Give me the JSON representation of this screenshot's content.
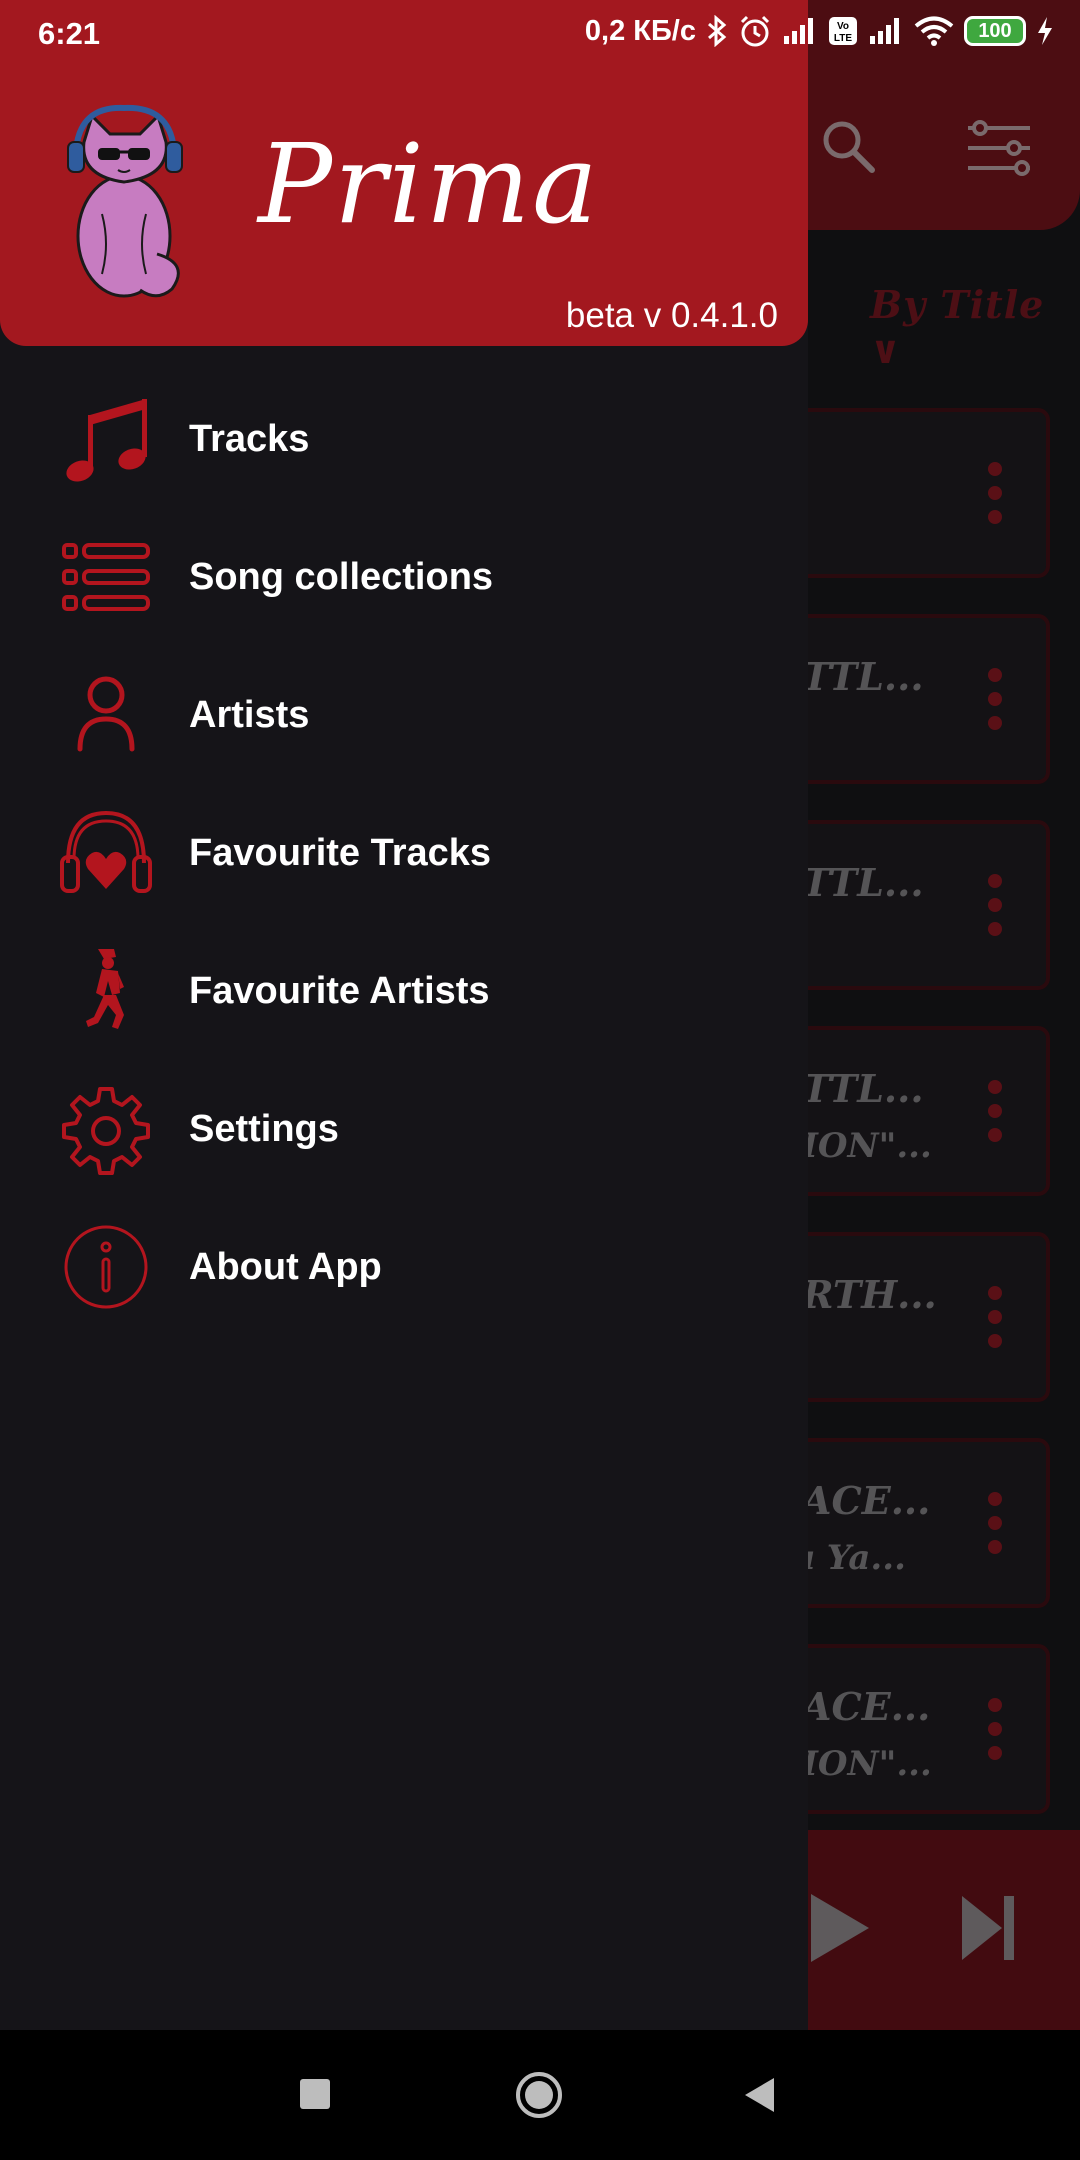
{
  "status_bar": {
    "time": "6:21",
    "network_speed": "0,2 КБ/с",
    "battery_level": "100"
  },
  "drawer": {
    "app_title": "Prima",
    "version": "beta v 0.4.1.0",
    "menu": [
      {
        "label": "Tracks",
        "icon": "music-notes-icon"
      },
      {
        "label": "Song collections",
        "icon": "list-icon"
      },
      {
        "label": "Artists",
        "icon": "person-icon"
      },
      {
        "label": "Favourite Tracks",
        "icon": "headphones-heart-icon"
      },
      {
        "label": "Favourite Artists",
        "icon": "dancer-icon"
      },
      {
        "label": "Settings",
        "icon": "gear-icon"
      },
      {
        "label": "About App",
        "icon": "info-icon"
      }
    ]
  },
  "background": {
    "sort_label": "By Title",
    "items": [
      {
        "t1": "",
        "t2": ""
      },
      {
        "t1": "TTL...",
        "t2": ""
      },
      {
        "t1": "TTL...",
        "t2": ""
      },
      {
        "t1": "TTL...",
        "t2": "ION\"..."
      },
      {
        "t1": "RTH...",
        "t2": ""
      },
      {
        "t1": "ACE...",
        "t2": "ı Ya..."
      },
      {
        "t1": "ACE...",
        "t2": "ION\"..."
      }
    ]
  },
  "colors": {
    "accent": "#a3181f",
    "drawer_bg": "#151418",
    "icon_red": "#b3151e"
  }
}
